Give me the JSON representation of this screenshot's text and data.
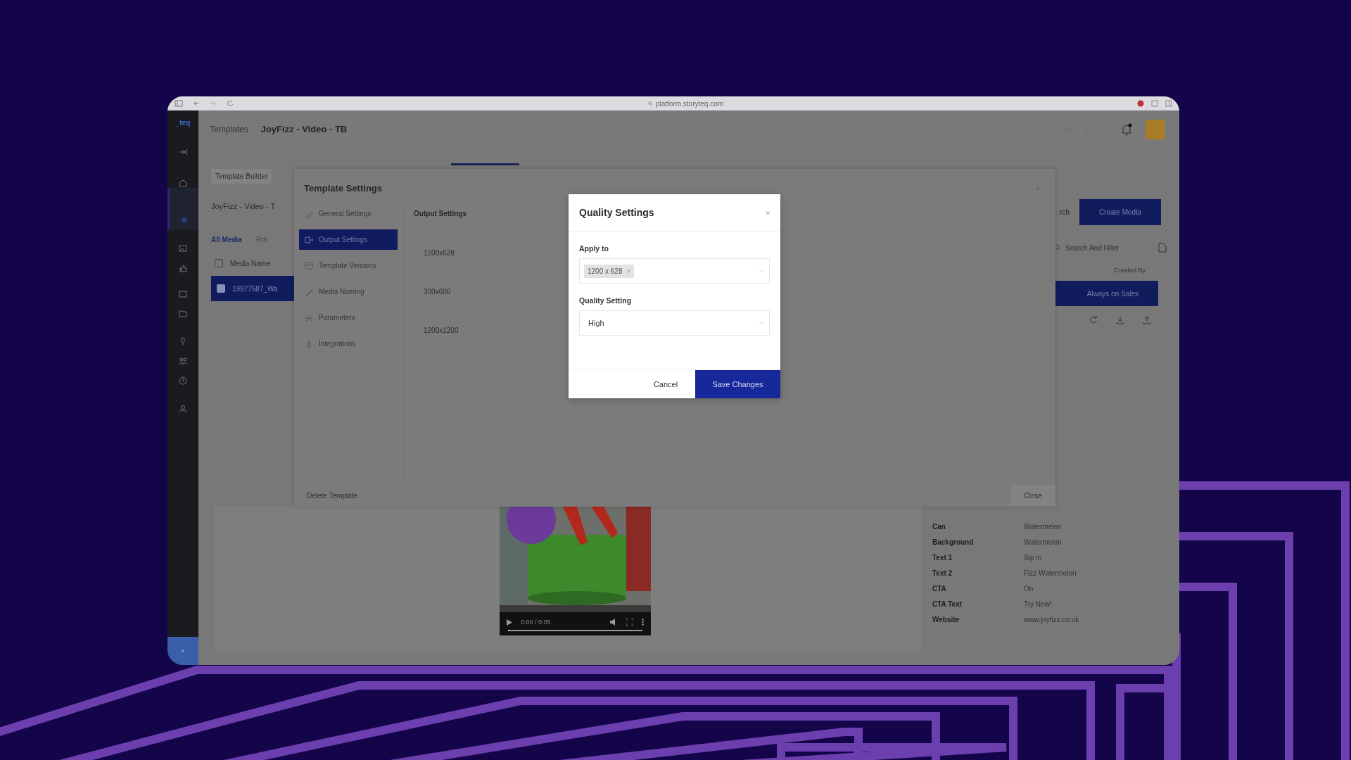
{
  "browser": {
    "url": "platform.storyteq.com"
  },
  "app": {
    "logo": "_teq",
    "breadcrumb": [
      "Templates",
      "JoyFizz - Video - TB"
    ],
    "notifications": {
      "unread": true
    }
  },
  "media_list": {
    "tab": "Template Builder",
    "template_name": "JoyFizz - Video - T",
    "filters": [
      {
        "label": "All Media",
        "selected": true
      },
      {
        "label": "Rot",
        "selected": false
      }
    ],
    "column": "Media Name",
    "column_checked": false,
    "rows": [
      {
        "name": "19977587_Wa",
        "selected": true,
        "checked": true
      }
    ]
  },
  "video": {
    "time": "0:00 / 0:05",
    "level": 0.0
  },
  "media_details": {
    "link": "rch",
    "create_button": "Create Media",
    "search": {
      "placeholder": "Search And Filter"
    },
    "column": "Created By",
    "rows": [
      {
        "label": "Always on Sales",
        "selected": true
      }
    ],
    "properties": [
      {
        "label": "Can",
        "value": "Watermelon"
      },
      {
        "label": "Background",
        "value": "Watermelon"
      },
      {
        "label": "Text 1",
        "value": "Sip in"
      },
      {
        "label": "Text 2",
        "value": "Fizz Watermelon"
      },
      {
        "label": "CTA",
        "value": "On"
      },
      {
        "label": "CTA Text",
        "value": "Try Now!"
      },
      {
        "label": "Website",
        "value": "www.joyfizz.co.uk"
      }
    ]
  },
  "template_settings": {
    "title": "Template Settings",
    "close_icon": "×",
    "nav": [
      {
        "label": "General Settings",
        "selected": false
      },
      {
        "label": "Output Settings",
        "selected": true
      },
      {
        "label": "Template Versions",
        "selected": false
      },
      {
        "label": "Media Naming",
        "selected": false
      },
      {
        "label": "Parameters",
        "selected": false
      },
      {
        "label": "Integrations",
        "selected": false
      }
    ],
    "section_title": "Output Settings",
    "sizes": [
      "1200x628",
      "300x600",
      "1200x1200"
    ],
    "delete_button": "Delete Template",
    "close_button": "Close"
  },
  "quality_modal": {
    "title": "Quality Settings",
    "close_icon": "×",
    "apply_label": "Apply to",
    "apply_chips": [
      {
        "label": "1200 x 628",
        "remove": "×"
      }
    ],
    "quality_label": "Quality Setting",
    "quality_value": "High",
    "cancel_button": "Cancel",
    "save_button": "Save Changes"
  }
}
